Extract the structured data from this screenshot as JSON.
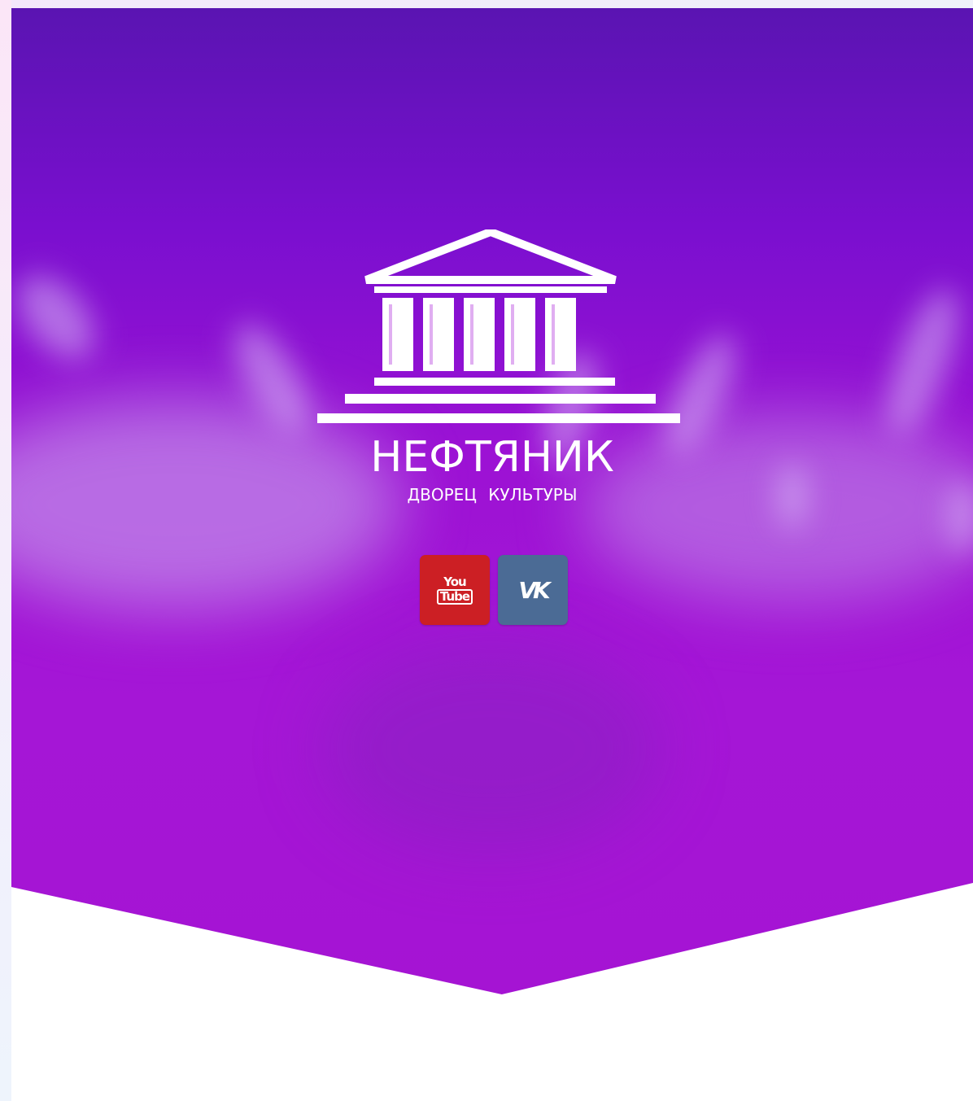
{
  "brand": {
    "name": "НЕФТЯНИК",
    "subtitle": "ДВОРЕЦ  КУЛЬТУРЫ"
  },
  "social": [
    {
      "name": "youtube",
      "icon": "youtube-icon",
      "text_top": "You",
      "text_bottom": "Tube",
      "color": "#cc1f24"
    },
    {
      "name": "vk",
      "icon": "vk-icon",
      "text": "VK",
      "color": "#4b6b95"
    }
  ],
  "colors": {
    "hero_top": "#5a14b2",
    "hero_mid": "#9c12d4",
    "hero_bottom": "#a514d3",
    "content_bg": "#ffffff"
  }
}
